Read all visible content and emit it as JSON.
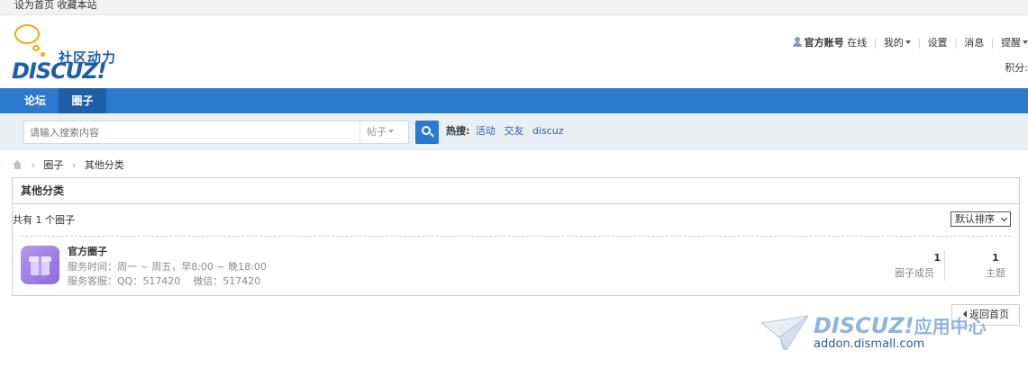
{
  "topbar": {
    "set_home": "设为首页",
    "bookmark": "收藏本站"
  },
  "logo": {
    "cn": "社区动力",
    "en": "DISCUZ!"
  },
  "userbar": {
    "username": "官方账号",
    "status": "在线",
    "my": "我的",
    "settings": "设置",
    "messages": "消息",
    "reminders": "提醒",
    "credit": "积分: "
  },
  "nav": {
    "forum": "论坛",
    "group": "圈子"
  },
  "search": {
    "placeholder": "请输入搜索内容",
    "type": "帖子",
    "hot_label": "热搜:",
    "hot_keywords": [
      "活动",
      "交友",
      "discuz"
    ]
  },
  "breadcrumb": {
    "items": [
      "圈子",
      "其他分类"
    ]
  },
  "panel": {
    "title": "其他分类",
    "count": "共有 1 个圈子",
    "sort": "默认排序"
  },
  "group": {
    "name": "官方圈子",
    "hours": "服务时间：周一 ~ 周五，早8:00 ~ 晚18:00",
    "qq": "服务客服：QQ：517420",
    "wechat": "微信：517420",
    "members": "1",
    "members_label": "圈子成员",
    "topics": "1",
    "topics_label": "主题"
  },
  "back": "返回首页",
  "watermark": {
    "brand": "DISCUZ!",
    "app": "应用中心",
    "url": "addon.dismall.com"
  },
  "colors": {
    "nav_bg": "#2b7acd",
    "nav_active": "#1e5fa8",
    "search_bg": "#e8eff5",
    "link": "#2b5fa0"
  },
  "icons": {
    "user": "user-icon",
    "search": "search-icon",
    "home": "home-icon",
    "group_avatar": "gift-box-icon"
  }
}
